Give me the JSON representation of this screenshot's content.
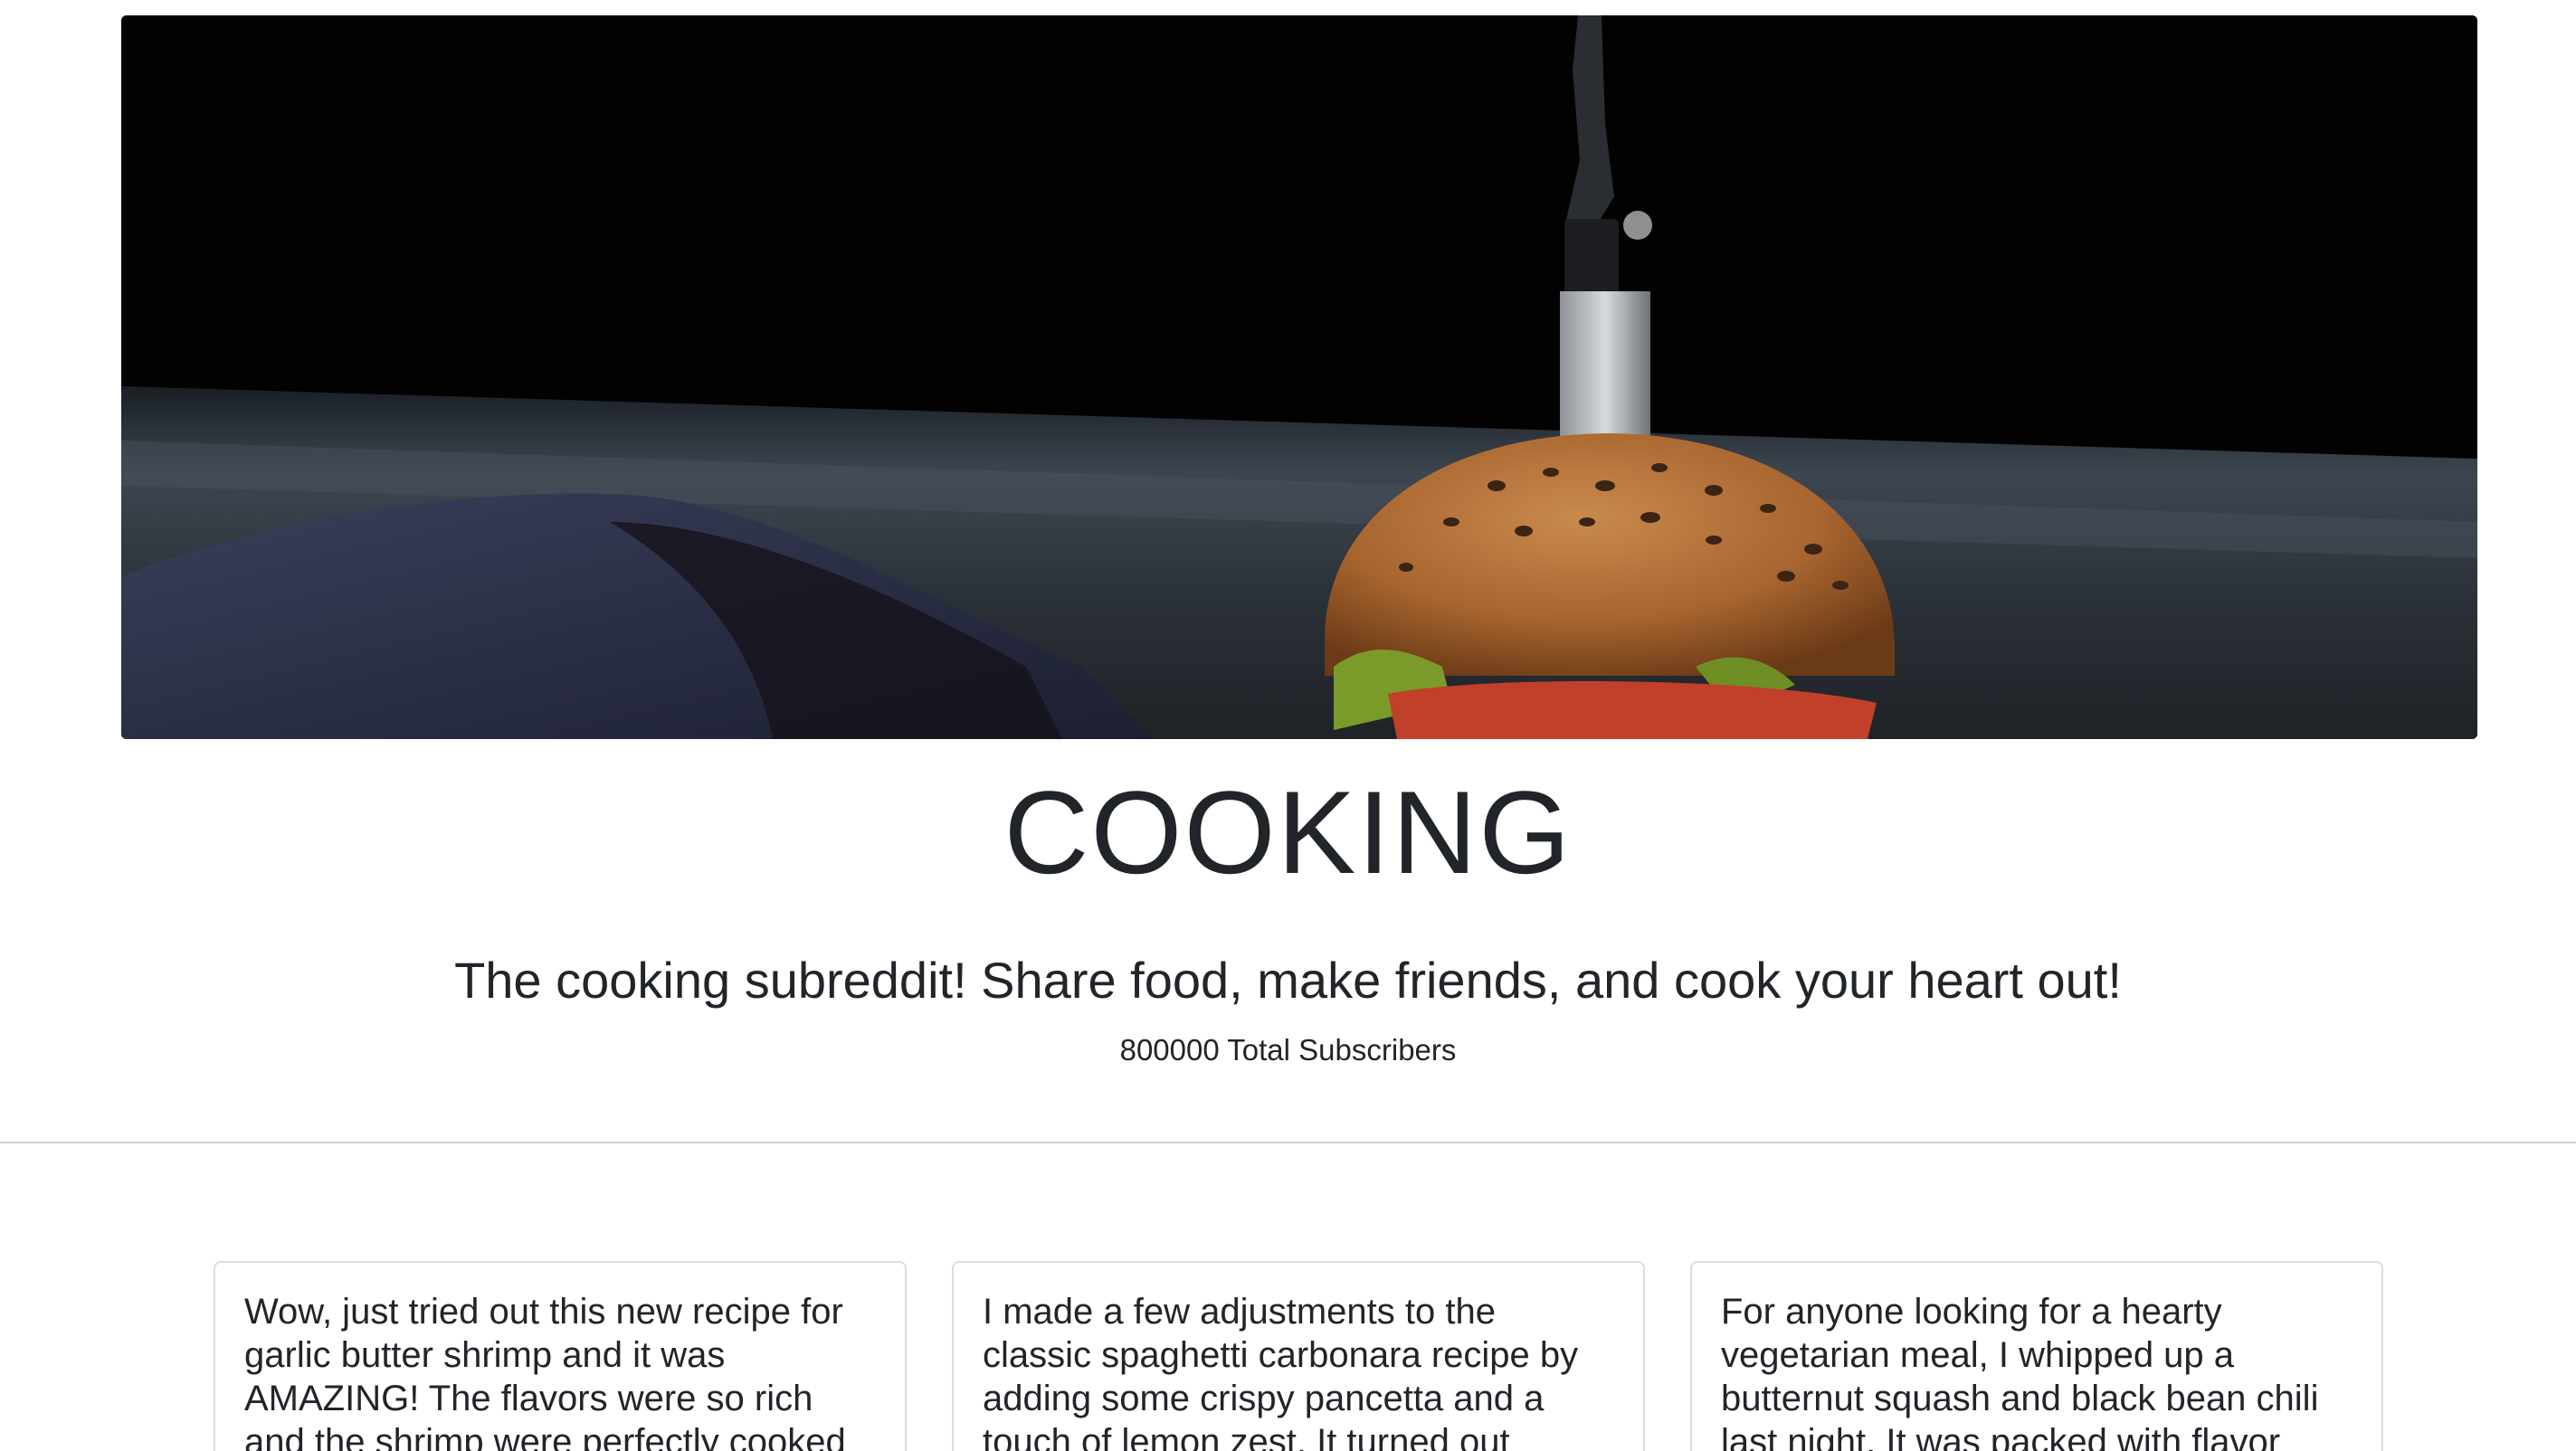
{
  "subreddit": {
    "name": "COOKING",
    "description": "The cooking subreddit! Share food, make friends, and cook your heart out!",
    "subscribers_text": "800000 Total Subscribers"
  },
  "posts": [
    {
      "text": "Wow, just tried out this new recipe for garlic butter shrimp and it was AMAZING! The flavors were so rich and the shrimp were perfectly cooked"
    },
    {
      "text": "I made a few adjustments to the classic spaghetti carbonara recipe by adding some crispy pancetta and a touch of lemon zest. It turned out"
    },
    {
      "text": "For anyone looking for a hearty vegetarian meal, I whipped up a butternut squash and black bean chili last night. It was packed with flavor"
    }
  ]
}
